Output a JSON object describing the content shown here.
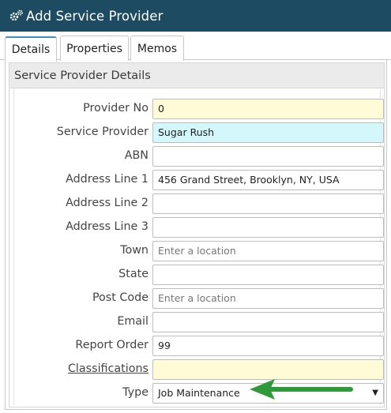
{
  "window": {
    "title": "Add Service Provider",
    "icon": "gears-icon"
  },
  "tabs": [
    {
      "label": "Details",
      "active": true
    },
    {
      "label": "Properties",
      "active": false
    },
    {
      "label": "Memos",
      "active": false
    }
  ],
  "section": {
    "title": "Service Provider Details"
  },
  "fields": [
    {
      "label": "Provider No",
      "value": "0",
      "placeholder": ""
    },
    {
      "label": "Service Provider",
      "value": "Sugar Rush",
      "placeholder": ""
    },
    {
      "label": "ABN",
      "value": "",
      "placeholder": ""
    },
    {
      "label": "Address Line 1",
      "value": "456 Grand Street, Brooklyn, NY, USA",
      "placeholder": ""
    },
    {
      "label": "Address Line 2",
      "value": "",
      "placeholder": ""
    },
    {
      "label": "Address Line 3",
      "value": "",
      "placeholder": ""
    },
    {
      "label": "Town",
      "value": "",
      "placeholder": "Enter a location"
    },
    {
      "label": "State",
      "value": "",
      "placeholder": ""
    },
    {
      "label": "Post Code",
      "value": "",
      "placeholder": "Enter a location"
    },
    {
      "label": "Email",
      "value": "",
      "placeholder": ""
    },
    {
      "label": "Report Order",
      "value": "99",
      "placeholder": ""
    },
    {
      "label": "Classifications",
      "value": "",
      "placeholder": ""
    },
    {
      "label": "Type",
      "value": "Job Maintenance",
      "placeholder": ""
    }
  ],
  "colors": {
    "titlebar": "#1d4b62",
    "required_yellow": "#fffbd6",
    "highlight_cyan": "#d3f7fb",
    "annotation_arrow": "#2e9a3a"
  },
  "annotation": {
    "icon": "green-arrow-icon"
  }
}
